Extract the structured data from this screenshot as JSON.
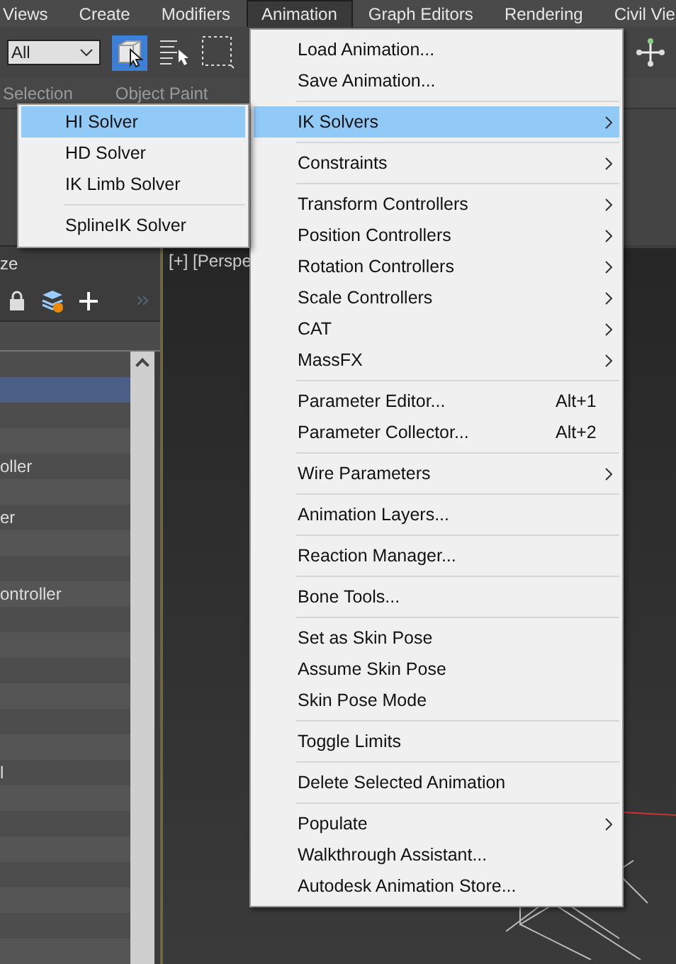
{
  "menubar": [
    {
      "label": "Views",
      "selected": false
    },
    {
      "label": "Create",
      "selected": false
    },
    {
      "label": "Modifiers",
      "selected": false
    },
    {
      "label": "Animation",
      "selected": true
    },
    {
      "label": "Graph Editors",
      "selected": false
    },
    {
      "label": "Rendering",
      "selected": false
    },
    {
      "label": "Civil Vie",
      "selected": false
    }
  ],
  "toolbar": {
    "filter": "All",
    "select_object_selected": true
  },
  "ribbon_tabs": [
    "Selection",
    "Object Paint"
  ],
  "panel": {
    "title": "ze",
    "rows": [
      {
        "selected": false
      },
      {
        "selected": true
      },
      {
        "selected": false
      },
      {
        "selected": false
      },
      {
        "label": "oller",
        "selected": false
      },
      {
        "selected": false
      },
      {
        "label": "er",
        "selected": false
      },
      {
        "selected": false
      },
      {
        "selected": false
      },
      {
        "label": "ontroller",
        "selected": false
      },
      {
        "selected": false
      },
      {
        "selected": false
      },
      {
        "selected": false
      },
      {
        "selected": false
      },
      {
        "selected": false
      },
      {
        "selected": false
      },
      {
        "label": "l",
        "selected": false
      },
      {
        "selected": false
      },
      {
        "selected": false
      },
      {
        "selected": false
      },
      {
        "selected": false
      },
      {
        "selected": false
      },
      {
        "selected": false
      },
      {
        "selected": false
      }
    ]
  },
  "viewport": {
    "label": "[+] [Perspe"
  },
  "menu": {
    "items": [
      {
        "kind": "item",
        "label": "Load Animation...",
        "selected": false,
        "submenu": false
      },
      {
        "kind": "item",
        "label": "Save Animation...",
        "selected": false,
        "submenu": false
      },
      {
        "kind": "separator"
      },
      {
        "kind": "item",
        "label": "IK Solvers",
        "selected": true,
        "submenu": true
      },
      {
        "kind": "separator"
      },
      {
        "kind": "item",
        "label": "Constraints",
        "selected": false,
        "submenu": true
      },
      {
        "kind": "separator"
      },
      {
        "kind": "item",
        "label": "Transform Controllers",
        "selected": false,
        "submenu": true
      },
      {
        "kind": "item",
        "label": "Position Controllers",
        "selected": false,
        "submenu": true
      },
      {
        "kind": "item",
        "label": "Rotation Controllers",
        "selected": false,
        "submenu": true
      },
      {
        "kind": "item",
        "label": "Scale Controllers",
        "selected": false,
        "submenu": true
      },
      {
        "kind": "item",
        "label": "CAT",
        "selected": false,
        "submenu": true
      },
      {
        "kind": "item",
        "label": "MassFX",
        "selected": false,
        "submenu": true
      },
      {
        "kind": "separator"
      },
      {
        "kind": "item",
        "label": "Parameter Editor...",
        "shortcut": "Alt+1",
        "selected": false,
        "submenu": false
      },
      {
        "kind": "item",
        "label": "Parameter Collector...",
        "shortcut": "Alt+2",
        "selected": false,
        "submenu": false
      },
      {
        "kind": "separator"
      },
      {
        "kind": "item",
        "label": "Wire Parameters",
        "selected": false,
        "submenu": true
      },
      {
        "kind": "separator"
      },
      {
        "kind": "item",
        "label": "Animation Layers...",
        "selected": false,
        "submenu": false
      },
      {
        "kind": "separator"
      },
      {
        "kind": "item",
        "label": "Reaction Manager...",
        "selected": false,
        "submenu": false
      },
      {
        "kind": "separator"
      },
      {
        "kind": "item",
        "label": "Bone Tools...",
        "selected": false,
        "submenu": false
      },
      {
        "kind": "separator"
      },
      {
        "kind": "item",
        "label": "Set as Skin Pose",
        "selected": false,
        "submenu": false
      },
      {
        "kind": "item",
        "label": "Assume Skin Pose",
        "selected": false,
        "submenu": false
      },
      {
        "kind": "item",
        "label": "Skin Pose Mode",
        "selected": false,
        "submenu": false
      },
      {
        "kind": "separator"
      },
      {
        "kind": "item",
        "label": "Toggle Limits",
        "selected": false,
        "submenu": false
      },
      {
        "kind": "separator"
      },
      {
        "kind": "item",
        "label": "Delete Selected Animation",
        "selected": false,
        "submenu": false
      },
      {
        "kind": "separator"
      },
      {
        "kind": "item",
        "label": "Populate",
        "selected": false,
        "submenu": true
      },
      {
        "kind": "item",
        "label": "Walkthrough Assistant...",
        "selected": false,
        "submenu": false
      },
      {
        "kind": "item",
        "label": "Autodesk Animation Store...",
        "selected": false,
        "submenu": false
      }
    ]
  },
  "submenu": {
    "items": [
      {
        "kind": "item",
        "label": "HI Solver",
        "selected": true
      },
      {
        "kind": "item",
        "label": "HD Solver",
        "selected": false
      },
      {
        "kind": "item",
        "label": "IK Limb Solver",
        "selected": false
      },
      {
        "kind": "separator"
      },
      {
        "kind": "item",
        "label": "SplineIK Solver",
        "selected": false
      }
    ]
  }
}
